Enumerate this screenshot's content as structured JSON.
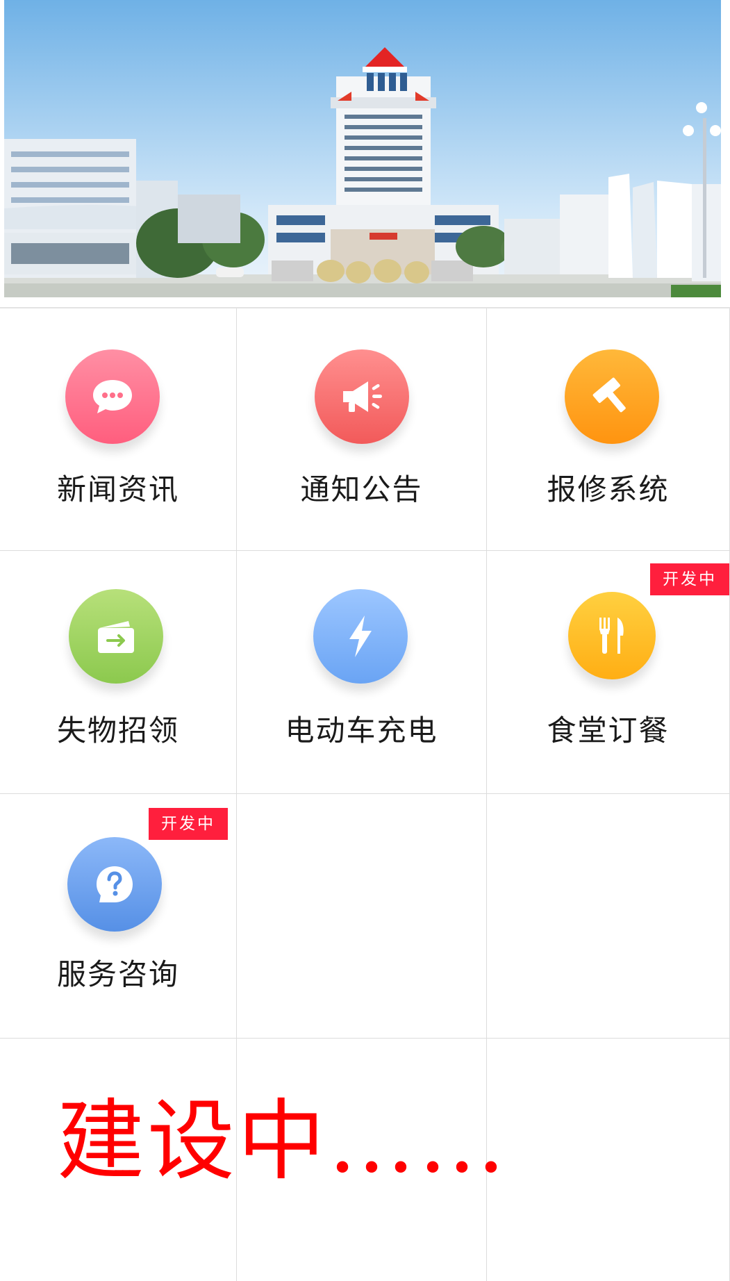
{
  "banner": {
    "alt": "campus-building-photo"
  },
  "grid": {
    "items": [
      {
        "label": "新闻资讯",
        "icon": "chat-bubble-icon",
        "color_top": "#ff8fa4",
        "color_bottom": "#ff5e7e",
        "badge": ""
      },
      {
        "label": "通知公告",
        "icon": "megaphone-icon",
        "color_top": "#ff8f8f",
        "color_bottom": "#f25a5a",
        "badge": ""
      },
      {
        "label": "报修系统",
        "icon": "hammer-icon",
        "color_top": "#ffb83a",
        "color_bottom": "#ff9410",
        "badge": ""
      },
      {
        "label": "失物招领",
        "icon": "wallet-icon",
        "color_top": "#b7e07a",
        "color_bottom": "#8cc94e",
        "badge": ""
      },
      {
        "label": "电动车充电",
        "icon": "lightning-icon",
        "color_top": "#9cc6ff",
        "color_bottom": "#6aa4f4",
        "badge": ""
      },
      {
        "label": "食堂订餐",
        "icon": "fork-knife-icon",
        "color_top": "#ffd040",
        "color_bottom": "#ffae14",
        "badge": "开发中"
      },
      {
        "label": "服务咨询",
        "icon": "question-icon",
        "color_top": "#8cb8f8",
        "color_bottom": "#5690e6",
        "badge": "开发中"
      }
    ]
  },
  "construction_text": "建设中……",
  "colors": {
    "badge": "#ff1f3d",
    "construction": "#ff0000",
    "divider": "#dcdcdc"
  }
}
